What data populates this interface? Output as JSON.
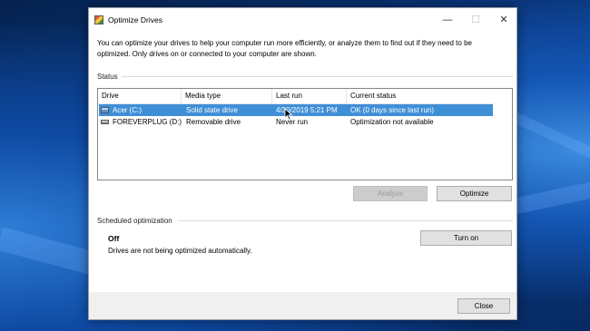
{
  "window": {
    "title": "Optimize Drives",
    "minimize_glyph": "—",
    "maximize_glyph": "☐",
    "close_glyph": "✕"
  },
  "description": "You can optimize your drives to help your computer run more efficiently, or analyze them to find out if they need to be optimized. Only drives on or connected to your computer are shown.",
  "status": {
    "group_label": "Status",
    "columns": [
      "Drive",
      "Media type",
      "Last run",
      "Current status"
    ],
    "rows": [
      {
        "drive": "Acer (C:)",
        "media_type": "Solid state drive",
        "last_run": "4/30/2019 5:21 PM",
        "current_status": "OK (0 days since last run)",
        "icon": "ssd-drive-icon",
        "selected": true
      },
      {
        "drive": "FOREVERPLUG (D:)",
        "media_type": "Removable drive",
        "last_run": "Never run",
        "current_status": "Optimization not available",
        "icon": "usb-drive-icon",
        "selected": false
      }
    ],
    "analyze_label": "Analyze",
    "optimize_label": "Optimize"
  },
  "scheduled": {
    "group_label": "Scheduled optimization",
    "state": "Off",
    "description": "Drives are not being optimized automatically.",
    "turn_on_label": "Turn on"
  },
  "footer": {
    "close_label": "Close"
  },
  "colors": {
    "selection": "#3f8fd6",
    "desktop": "#0b3a86"
  }
}
